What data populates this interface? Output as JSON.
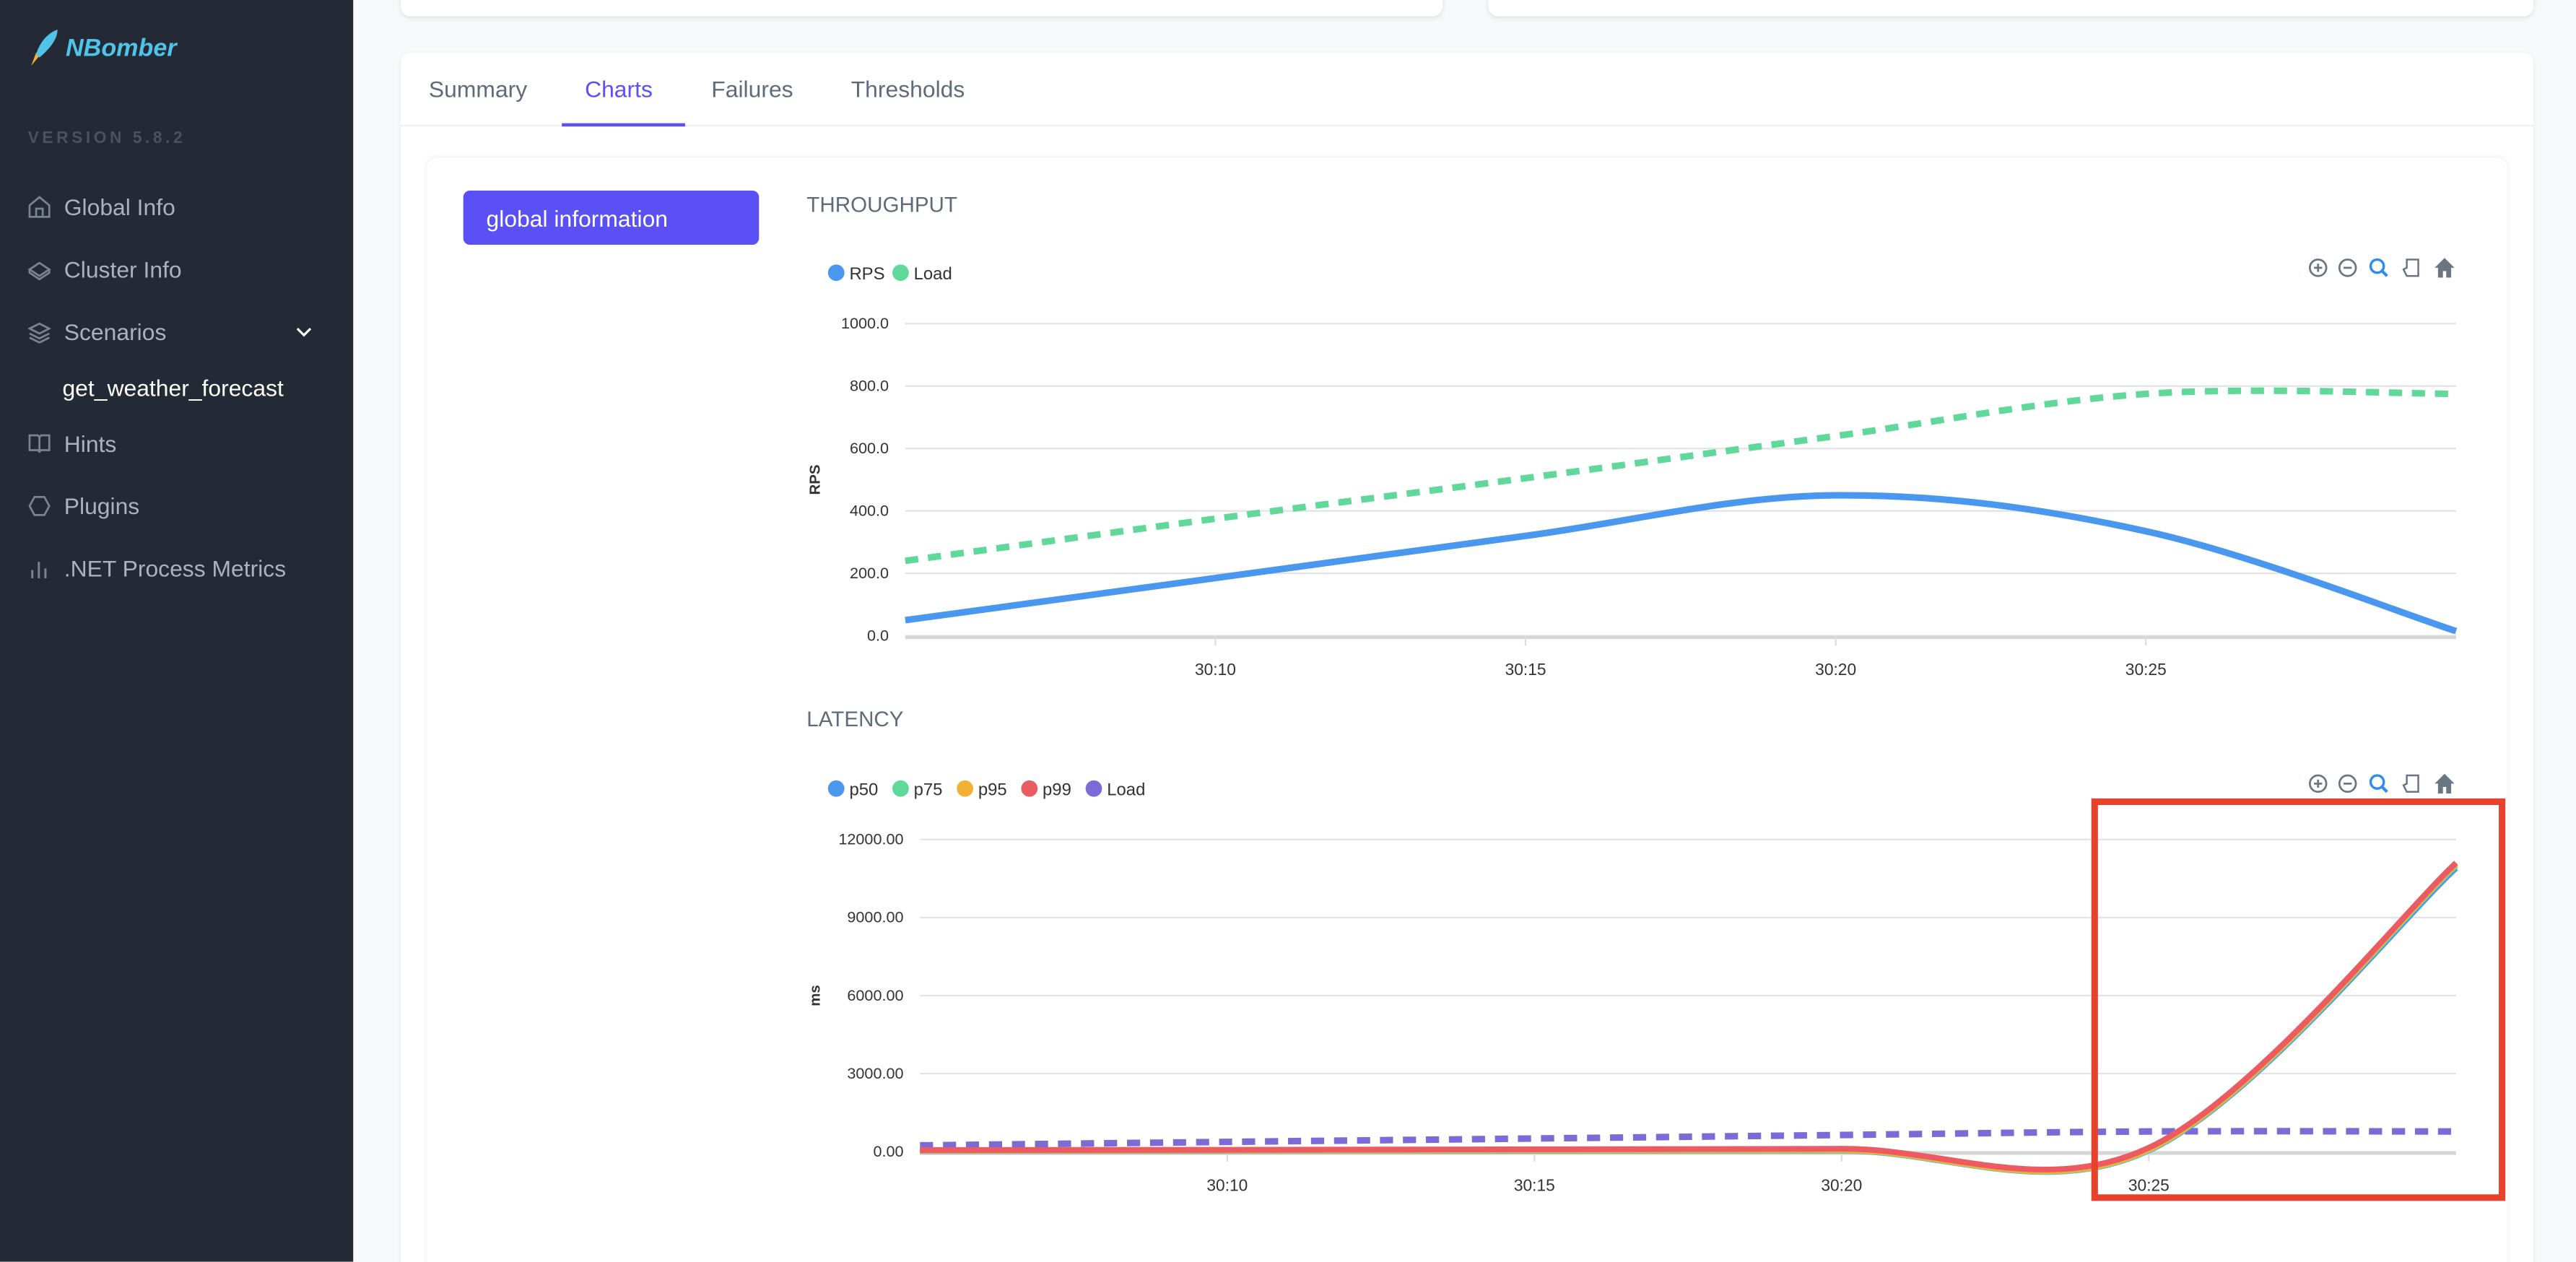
{
  "sidebar": {
    "brand": "NBomber",
    "version": "VERSION 5.8.2",
    "items": [
      {
        "label": "Global Info",
        "icon": "home-icon"
      },
      {
        "label": "Cluster Info",
        "icon": "cube-icon"
      },
      {
        "label": "Scenarios",
        "icon": "layers-icon"
      },
      {
        "label": "Hints",
        "icon": "book-icon"
      },
      {
        "label": "Plugins",
        "icon": "hexagon-icon"
      },
      {
        "label": ".NET Process Metrics",
        "icon": "bar-chart-icon"
      }
    ],
    "scenario_sub": "get_weather_forecast"
  },
  "tabs": [
    {
      "label": "Summary"
    },
    {
      "label": "Charts",
      "active": true
    },
    {
      "label": "Failures"
    },
    {
      "label": "Thresholds"
    }
  ],
  "global_info_button": "global information",
  "toolbar_icons": [
    "zoom-in-icon",
    "zoom-out-icon",
    "selection-zoom-icon",
    "pan-icon",
    "reset-home-icon"
  ],
  "annotation_color": "#e8412c",
  "chart_data": [
    {
      "type": "line",
      "title": "THROUGHPUT",
      "ylabel": "RPS",
      "xlabel": "",
      "x": [
        "30:05",
        "30:10",
        "30:15",
        "30:20",
        "30:25",
        "30:30"
      ],
      "xticks": [
        "30:10",
        "30:15",
        "30:20",
        "30:25"
      ],
      "ylim": [
        0,
        1000
      ],
      "yticks": [
        "0.0",
        "200.0",
        "400.0",
        "600.0",
        "800.0",
        "1000.0"
      ],
      "grid": true,
      "legend": "top-left",
      "series": [
        {
          "name": "RPS",
          "color": "#4a97f0",
          "dashed": false,
          "values": [
            50,
            185,
            320,
            450,
            335,
            15
          ]
        },
        {
          "name": "Load",
          "color": "#5fd89a",
          "dashed": true,
          "values": [
            240,
            375,
            505,
            640,
            775,
            775
          ]
        }
      ]
    },
    {
      "type": "line",
      "title": "LATENCY",
      "ylabel": "ms",
      "xlabel": "",
      "x": [
        "30:05",
        "30:10",
        "30:15",
        "30:20",
        "30:25",
        "30:30"
      ],
      "xticks": [
        "30:10",
        "30:15",
        "30:20",
        "30:25"
      ],
      "ylim": [
        0,
        12000
      ],
      "yticks": [
        "0.00",
        "3000.00",
        "6000.00",
        "9000.00",
        "12000.00"
      ],
      "grid": true,
      "legend": "top-left",
      "series": [
        {
          "name": "p50",
          "color": "#4a97f0",
          "dashed": false,
          "values": [
            20,
            25,
            30,
            35,
            40,
            10900
          ]
        },
        {
          "name": "p75",
          "color": "#5fd89a",
          "dashed": false,
          "values": [
            30,
            35,
            40,
            45,
            60,
            11000
          ]
        },
        {
          "name": "p95",
          "color": "#f2b134",
          "dashed": false,
          "values": [
            40,
            45,
            55,
            60,
            80,
            11050
          ]
        },
        {
          "name": "p99",
          "color": "#ec5b61",
          "dashed": false,
          "values": [
            60,
            70,
            90,
            110,
            150,
            11100
          ]
        },
        {
          "name": "Load",
          "color": "#7c6bd6",
          "dashed": true,
          "values": [
            240,
            375,
            505,
            640,
            775,
            775
          ]
        }
      ]
    }
  ]
}
